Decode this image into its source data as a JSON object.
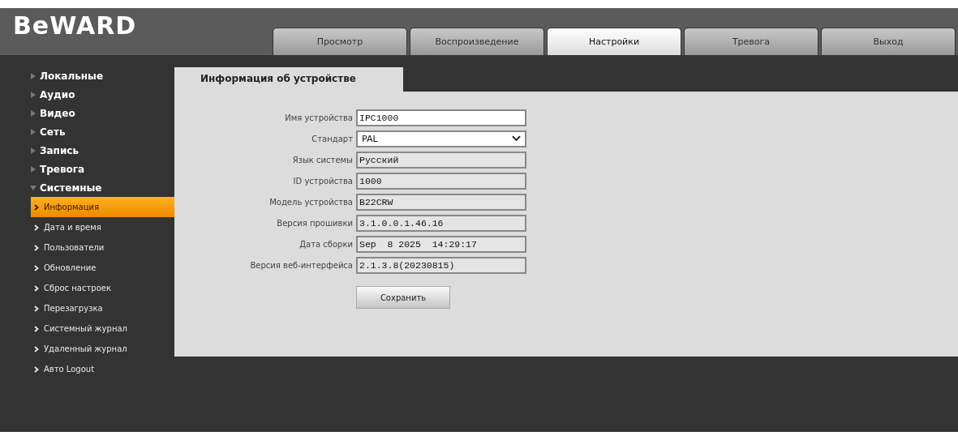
{
  "logo": "BeWARD",
  "tabs": [
    {
      "label": "Просмотр",
      "selected": false
    },
    {
      "label": "Воспроизведение",
      "selected": false
    },
    {
      "label": "Настройки",
      "selected": true
    },
    {
      "label": "Тревога",
      "selected": false
    },
    {
      "label": "Выход",
      "selected": false
    }
  ],
  "sidebar": {
    "items": [
      {
        "label": "Локальные",
        "expanded": false
      },
      {
        "label": "Аудио",
        "expanded": false
      },
      {
        "label": "Видео",
        "expanded": false
      },
      {
        "label": "Сеть",
        "expanded": false
      },
      {
        "label": "Запись",
        "expanded": false
      },
      {
        "label": "Тревога",
        "expanded": false
      },
      {
        "label": "Системные",
        "expanded": true,
        "children": [
          {
            "label": "Информация",
            "selected": true
          },
          {
            "label": "Дата и время",
            "selected": false
          },
          {
            "label": "Пользователи",
            "selected": false
          },
          {
            "label": "Обновление",
            "selected": false
          },
          {
            "label": "Сброс настроек",
            "selected": false
          },
          {
            "label": "Перезагрузка",
            "selected": false
          },
          {
            "label": "Системный журнал",
            "selected": false
          },
          {
            "label": "Удаленный журнал",
            "selected": false
          },
          {
            "label": "Авто Logout",
            "selected": false
          }
        ]
      }
    ]
  },
  "panel": {
    "title": "Информация об устройстве",
    "fields": [
      {
        "label": "Имя устройства",
        "value": "IPC1000",
        "kind": "text"
      },
      {
        "label": "Стандарт",
        "value": "PAL",
        "kind": "select"
      },
      {
        "label": "Язык системы",
        "value": "Русский",
        "kind": "readonly"
      },
      {
        "label": "ID устройства",
        "value": "1000",
        "kind": "readonly"
      },
      {
        "label": "Модель устройства",
        "value": "B22CRW",
        "kind": "readonly"
      },
      {
        "label": "Версия прошивки",
        "value": "3.1.0.0.1.46.16",
        "kind": "readonly"
      },
      {
        "label": "Дата сборки",
        "value": "Sep  8 2025  14:29:17",
        "kind": "readonly"
      },
      {
        "label": "Версия веб-интерфейса",
        "value": "2.1.3.8(20230815)",
        "kind": "readonly"
      }
    ],
    "save_button": "Сохранить"
  }
}
